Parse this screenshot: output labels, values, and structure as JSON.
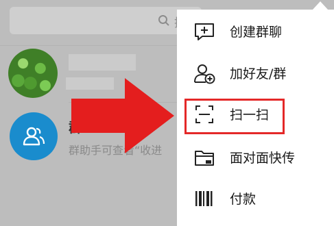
{
  "search": {
    "label": "搜"
  },
  "chats": [
    {
      "type": "contact"
    },
    {
      "type": "group",
      "title_fragment": "群",
      "message": "群助手可查看“收进"
    }
  ],
  "menu": {
    "items": [
      {
        "label": "创建群聊",
        "icon": "create-group-chat-icon"
      },
      {
        "label": "加好友/群",
        "icon": "add-friend-icon"
      },
      {
        "label": "扫一扫",
        "icon": "scan-icon"
      },
      {
        "label": "面对面快传",
        "icon": "folder-transfer-icon"
      },
      {
        "label": "付款",
        "icon": "barcode-pay-icon"
      }
    ]
  },
  "colors": {
    "accent_blue": "#1a8ccd",
    "highlight_red": "#e42828",
    "arrow_red": "#e41e1e",
    "overlay_gray": "#bdbdbd"
  }
}
